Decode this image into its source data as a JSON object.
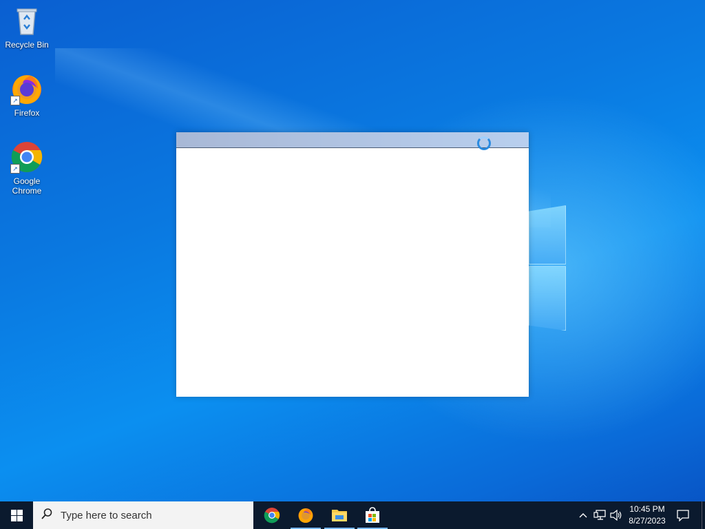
{
  "desktop": {
    "icons": [
      {
        "label": "Recycle Bin",
        "icon": "recycle-bin-icon"
      },
      {
        "label": "Firefox",
        "icon": "firefox-icon"
      },
      {
        "label_line1": "Google",
        "label_line2": "Chrome",
        "icon": "chrome-icon"
      }
    ]
  },
  "splash_window": {
    "state": "loading",
    "icon": "loading-spinner-icon"
  },
  "taskbar": {
    "start_icon": "windows-start-icon",
    "search_placeholder": "Type here to search",
    "pinned_apps": [
      {
        "name": "Google Chrome",
        "icon": "chrome-icon",
        "active": true
      },
      {
        "name": "Firefox",
        "icon": "firefox-icon",
        "active": true
      },
      {
        "name": "File Explorer",
        "icon": "file-explorer-icon",
        "active": true
      },
      {
        "name": "Microsoft Store",
        "icon": "store-icon",
        "active": true
      }
    ],
    "tray_icons": [
      "chevron-up-icon",
      "network-icon",
      "volume-icon"
    ],
    "clock": {
      "time": "10:45 PM",
      "date": "8/27/2023"
    },
    "notification_icon": "action-center-icon"
  },
  "colors": {
    "desktop_blue": "#0a78e0",
    "taskbar_bg": "#0b1a2e",
    "spinner_blue": "#2a8be0"
  }
}
